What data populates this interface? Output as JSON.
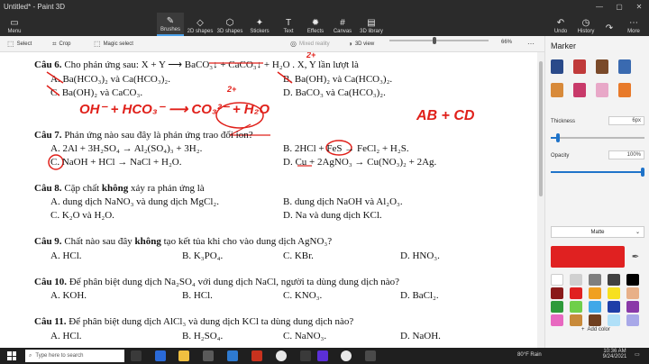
{
  "window": {
    "title": "Untitled* - Paint 3D",
    "menu_label": "Menu",
    "undo_label": "Undo",
    "history_label": "History",
    "more_label": "More"
  },
  "ribbon": {
    "tabs": [
      {
        "label": "Brushes",
        "icon": "brush-icon"
      },
      {
        "label": "2D shapes",
        "icon": "shapes-2d-icon"
      },
      {
        "label": "3D shapes",
        "icon": "shapes-3d-icon"
      },
      {
        "label": "Stickers",
        "icon": "stickers-icon"
      },
      {
        "label": "Text",
        "icon": "text-icon"
      },
      {
        "label": "Effects",
        "icon": "effects-icon"
      },
      {
        "label": "Canvas",
        "icon": "canvas-icon"
      },
      {
        "label": "3D library",
        "icon": "library-icon"
      }
    ]
  },
  "toolbar": {
    "select": "Select",
    "crop": "Crop",
    "magic_select": "Magic select",
    "mixed_reality": "Mixed reality",
    "view_3d": "3D view",
    "zoom": "66%"
  },
  "document": {
    "q6_title": "Câu 6.",
    "q6_text": "Cho phản ứng sau:  X + Y ⟶ BaCO₃↓ + CaCO₃↓ + H₂O . X, Y lần lượt là",
    "q6_a": "A. Ba(HCO₃)₂ và Ca(HCO₃)₂.",
    "q6_b": "B. Ba(OH)₂ và Ca(HCO₃)₂.",
    "q6_c": "C. Ba(OH)₂ và CaCO₃.",
    "q6_d": "D. BaCO₃ và Ca(HCO₃)₂.",
    "q7_title": "Câu 7.",
    "q7_text": "Phản ứng nào sau đây là phản ứng trao đổi ion?",
    "q7_a": "A. 2Al + 3H₂SO₄ → Al₂(SO₄)₃ + 3H₂.",
    "q7_b": "B. 2HCl + FeS → FeCl₂ + H₂S.",
    "q7_c": "C. NaOH + HCl → NaCl + H₂O.",
    "q7_d": "D. Cu + 2AgNO₃ → Cu(NO₃)₂ + 2Ag.",
    "q8_title": "Câu 8.",
    "q8_text_a": "Cặp chất ",
    "q8_text_b": "không",
    "q8_text_c": " xảy ra phản ứng là",
    "q8_a": "A. dung dịch NaNO₃ và dung dịch MgCl₂.",
    "q8_b": "B. dung dịch NaOH và Al₂O₃.",
    "q8_c": "C. K₂O và H₂O.",
    "q8_d": "D. Na và dung dịch KCl.",
    "q9_title": "Câu 9.",
    "q9_text_a": "Chất nào sau đây ",
    "q9_text_b": "không",
    "q9_text_c": " tạo kết tủa khi cho vào dung dịch AgNO₃?",
    "q9_a": "A. HCl.",
    "q9_b": "B. K₃PO₄.",
    "q9_c": "C. KBr.",
    "q9_d": "D. HNO₃.",
    "q10_title": "Câu 10.",
    "q10_text": "Để phân biệt dung dịch Na₂SO₄ với dung dịch NaCl, người ta dùng dung dịch nào?",
    "q10_a": "A. KOH.",
    "q10_b": "B. HCl.",
    "q10_c": "C. KNO₃.",
    "q10_d": "D. BaCl₂.",
    "q11_title": "Câu 11.",
    "q11_text": "Để phân biệt dung dịch AlCl₃ và dung dịch KCl ta dùng dung dịch nào?",
    "q11_a": "A. HCl.",
    "q11_b": "B. H₂SO₄.",
    "q11_c": "C. NaNO₃.",
    "q11_d": "D. NaOH."
  },
  "annotations": {
    "ink_eq": "OH⁻ + HCO₃⁻ ⟶ CO₃²⁻ + H₂O",
    "ink_ab": "AB + CD",
    "ink_2plus": "2+",
    "ink_2plus_b": "2+"
  },
  "panel": {
    "title": "Marker",
    "thickness_label": "Thickness",
    "thickness_value": "6px",
    "opacity_label": "Opacity",
    "opacity_value": "100%",
    "thickness_fraction": 0.06,
    "opacity_fraction": 1.0,
    "finish": "Matte",
    "add_color": "Add color",
    "selected_color": "#e02121",
    "palette": [
      "#ffffff",
      "#d0d0d0",
      "#7f7f7f",
      "#404040",
      "#000000",
      "#8a1a1a",
      "#e02121",
      "#f0a020",
      "#f7e020",
      "#e8b088",
      "#2e9a3a",
      "#6fcf4a",
      "#40a8e8",
      "#1f3fa8",
      "#8a3aa8",
      "#e868c0",
      "#c88a3a",
      "#704020",
      "#b0e0f8",
      "#a8a8e8"
    ]
  },
  "taskbar": {
    "search_placeholder": "Type here to search",
    "weather": "80°F  Rain",
    "time": "10:36 AM",
    "date": "9/24/2021"
  }
}
